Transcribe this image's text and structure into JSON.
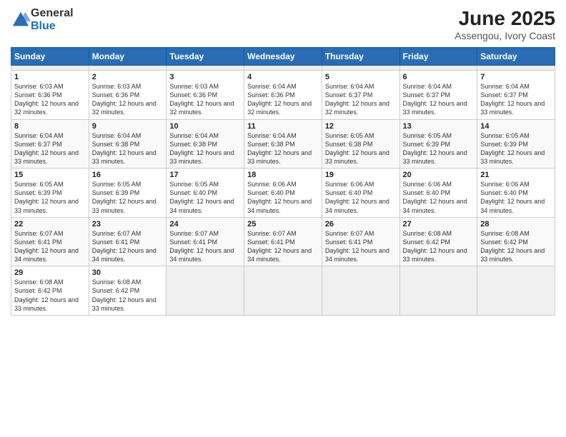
{
  "header": {
    "logo_general": "General",
    "logo_blue": "Blue",
    "title": "June 2025",
    "subtitle": "Assengou, Ivory Coast"
  },
  "calendar": {
    "days": [
      "Sunday",
      "Monday",
      "Tuesday",
      "Wednesday",
      "Thursday",
      "Friday",
      "Saturday"
    ],
    "weeks": [
      [
        {
          "date": "",
          "empty": true
        },
        {
          "date": "",
          "empty": true
        },
        {
          "date": "",
          "empty": true
        },
        {
          "date": "",
          "empty": true
        },
        {
          "date": "",
          "empty": true
        },
        {
          "date": "",
          "empty": true
        },
        {
          "date": "",
          "empty": true
        }
      ],
      [
        {
          "date": "1",
          "sunrise": "6:03 AM",
          "sunset": "6:36 PM",
          "daylight": "12 hours and 32 minutes."
        },
        {
          "date": "2",
          "sunrise": "6:03 AM",
          "sunset": "6:36 PM",
          "daylight": "12 hours and 32 minutes."
        },
        {
          "date": "3",
          "sunrise": "6:03 AM",
          "sunset": "6:36 PM",
          "daylight": "12 hours and 32 minutes."
        },
        {
          "date": "4",
          "sunrise": "6:04 AM",
          "sunset": "6:36 PM",
          "daylight": "12 hours and 32 minutes."
        },
        {
          "date": "5",
          "sunrise": "6:04 AM",
          "sunset": "6:37 PM",
          "daylight": "12 hours and 32 minutes."
        },
        {
          "date": "6",
          "sunrise": "6:04 AM",
          "sunset": "6:37 PM",
          "daylight": "12 hours and 33 minutes."
        },
        {
          "date": "7",
          "sunrise": "6:04 AM",
          "sunset": "6:37 PM",
          "daylight": "12 hours and 33 minutes."
        }
      ],
      [
        {
          "date": "8",
          "sunrise": "6:04 AM",
          "sunset": "6:37 PM",
          "daylight": "12 hours and 33 minutes."
        },
        {
          "date": "9",
          "sunrise": "6:04 AM",
          "sunset": "6:38 PM",
          "daylight": "12 hours and 33 minutes."
        },
        {
          "date": "10",
          "sunrise": "6:04 AM",
          "sunset": "6:38 PM",
          "daylight": "12 hours and 33 minutes."
        },
        {
          "date": "11",
          "sunrise": "6:04 AM",
          "sunset": "6:38 PM",
          "daylight": "12 hours and 33 minutes."
        },
        {
          "date": "12",
          "sunrise": "6:05 AM",
          "sunset": "6:38 PM",
          "daylight": "12 hours and 33 minutes."
        },
        {
          "date": "13",
          "sunrise": "6:05 AM",
          "sunset": "6:39 PM",
          "daylight": "12 hours and 33 minutes."
        },
        {
          "date": "14",
          "sunrise": "6:05 AM",
          "sunset": "6:39 PM",
          "daylight": "12 hours and 33 minutes."
        }
      ],
      [
        {
          "date": "15",
          "sunrise": "6:05 AM",
          "sunset": "6:39 PM",
          "daylight": "12 hours and 33 minutes."
        },
        {
          "date": "16",
          "sunrise": "6:05 AM",
          "sunset": "6:39 PM",
          "daylight": "12 hours and 33 minutes."
        },
        {
          "date": "17",
          "sunrise": "6:05 AM",
          "sunset": "6:40 PM",
          "daylight": "12 hours and 34 minutes."
        },
        {
          "date": "18",
          "sunrise": "6:06 AM",
          "sunset": "6:40 PM",
          "daylight": "12 hours and 34 minutes."
        },
        {
          "date": "19",
          "sunrise": "6:06 AM",
          "sunset": "6:40 PM",
          "daylight": "12 hours and 34 minutes."
        },
        {
          "date": "20",
          "sunrise": "6:06 AM",
          "sunset": "6:40 PM",
          "daylight": "12 hours and 34 minutes."
        },
        {
          "date": "21",
          "sunrise": "6:06 AM",
          "sunset": "6:40 PM",
          "daylight": "12 hours and 34 minutes."
        }
      ],
      [
        {
          "date": "22",
          "sunrise": "6:07 AM",
          "sunset": "6:41 PM",
          "daylight": "12 hours and 34 minutes."
        },
        {
          "date": "23",
          "sunrise": "6:07 AM",
          "sunset": "6:41 PM",
          "daylight": "12 hours and 34 minutes."
        },
        {
          "date": "24",
          "sunrise": "6:07 AM",
          "sunset": "6:41 PM",
          "daylight": "12 hours and 34 minutes."
        },
        {
          "date": "25",
          "sunrise": "6:07 AM",
          "sunset": "6:41 PM",
          "daylight": "12 hours and 34 minutes."
        },
        {
          "date": "26",
          "sunrise": "6:07 AM",
          "sunset": "6:41 PM",
          "daylight": "12 hours and 34 minutes."
        },
        {
          "date": "27",
          "sunrise": "6:08 AM",
          "sunset": "6:42 PM",
          "daylight": "12 hours and 33 minutes."
        },
        {
          "date": "28",
          "sunrise": "6:08 AM",
          "sunset": "6:42 PM",
          "daylight": "12 hours and 33 minutes."
        }
      ],
      [
        {
          "date": "29",
          "sunrise": "6:08 AM",
          "sunset": "6:42 PM",
          "daylight": "12 hours and 33 minutes."
        },
        {
          "date": "30",
          "sunrise": "6:08 AM",
          "sunset": "6:42 PM",
          "daylight": "12 hours and 33 minutes."
        },
        {
          "date": "",
          "empty": true
        },
        {
          "date": "",
          "empty": true
        },
        {
          "date": "",
          "empty": true
        },
        {
          "date": "",
          "empty": true
        },
        {
          "date": "",
          "empty": true
        }
      ]
    ]
  }
}
